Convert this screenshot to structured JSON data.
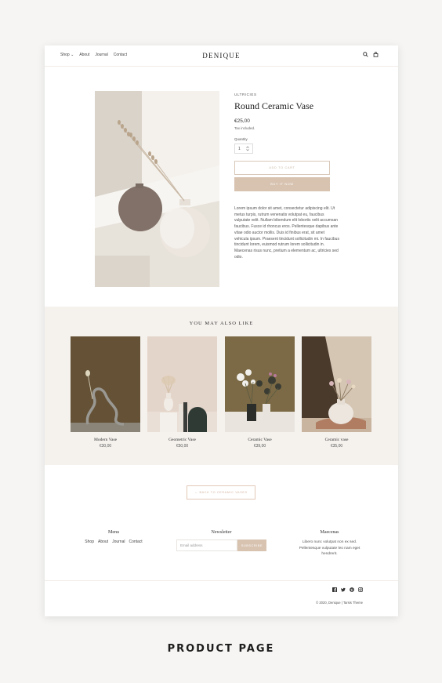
{
  "header": {
    "nav": [
      "Shop ⌄",
      "About",
      "Journal",
      "Contact"
    ],
    "logo": "DENIQUE",
    "icons": [
      "search-icon",
      "cart-icon"
    ]
  },
  "product": {
    "vendor": "ULTRICIES",
    "title": "Round Ceramic Vase",
    "price": "€25,00",
    "tax": "Tax included.",
    "quantity_label": "Quantity",
    "quantity_value": "1",
    "add_to_cart": "ADD TO CART",
    "buy_now": "BUY IT NOW",
    "description": "Lorem ipsum dolor sit amet, consectetur adipiscing elit. Ut metus turpis, rutrum venenatis volutpat eu, faucibus vulputate velit. Nullam bibendum elit lobortis velit accumsan faucibus. Fusce id rhoncus eros. Pellentesque dapibus ante vitae odio auctor mollis. Duis id finibus erat, sit amet vehicula ipsum. Praesent tincidunt sollicitudin mi. In faucibus tincidunt lorem, euismod rutrum lorem sollicitudin in. Maecenas risus nunc, pretium a elementum ac, ultricies sed odio."
  },
  "related": {
    "title": "YOU MAY ALSO LIKE",
    "items": [
      {
        "name": "Modern Vase",
        "price": "€30,00"
      },
      {
        "name": "Geometric Vase",
        "price": "€50,00"
      },
      {
        "name": "Ceramic Vase",
        "price": "€39,00"
      },
      {
        "name": "Ceramic vase",
        "price": "€35,00"
      }
    ]
  },
  "back_button": "← BACK TO CERAMIC VASES",
  "footer": {
    "menu_title": "Menu",
    "menu_items": [
      "Shop",
      "About",
      "Journal",
      "Contact"
    ],
    "newsletter_title": "Newsletter",
    "newsletter_placeholder": "Email address",
    "newsletter_button": "SUBSCRIBE",
    "brand_title": "Maecenas",
    "brand_text": "Libero nunc volutpat non ex sed. Pellentesque vulputate leo nam eget hendrerit.",
    "social": [
      "facebook-icon",
      "twitter-icon",
      "pinterest-icon",
      "instagram-icon"
    ],
    "copyright": "© 2020, Denique | Tarsis Theme"
  },
  "caption": "PRODUCT PAGE",
  "colors": {
    "accent": "#d8c3b1",
    "related_bg": "#f5f2ee"
  }
}
